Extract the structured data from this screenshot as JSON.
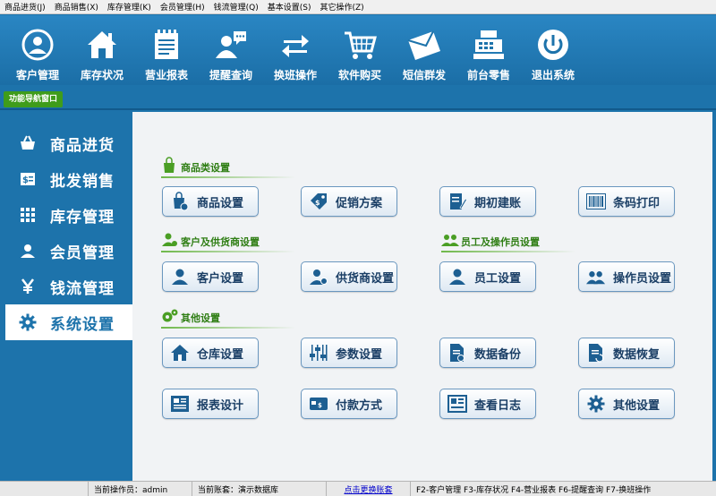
{
  "menu": [
    "商品进货(J)",
    "商品销售(X)",
    "库存管理(K)",
    "会员管理(H)",
    "钱流管理(Q)",
    "基本设置(S)",
    "其它操作(Z)"
  ],
  "toolbar": [
    {
      "label": "客户管理",
      "icon": "user-circle-icon"
    },
    {
      "label": "库存状况",
      "icon": "house-icon"
    },
    {
      "label": "营业报表",
      "icon": "notepad-icon"
    },
    {
      "label": "提醒查询",
      "icon": "chat-person-icon"
    },
    {
      "label": "换班操作",
      "icon": "swap-arrows-icon"
    },
    {
      "label": "软件购买",
      "icon": "cart-icon"
    },
    {
      "label": "短信群发",
      "icon": "envelope-icon"
    },
    {
      "label": "前台零售",
      "icon": "cash-register-icon"
    },
    {
      "label": "退出系统",
      "icon": "power-icon"
    }
  ],
  "nav_label": "功能导航窗口",
  "sidebar": [
    {
      "label": "商品进货",
      "icon": "basket-icon",
      "active": false
    },
    {
      "label": "批发销售",
      "icon": "price-tag-icon",
      "active": false
    },
    {
      "label": "库存管理",
      "icon": "grid-icon",
      "active": false
    },
    {
      "label": "会员管理",
      "icon": "person-icon",
      "active": false
    },
    {
      "label": "钱流管理",
      "icon": "yen-icon",
      "active": false
    },
    {
      "label": "系统设置",
      "icon": "gear-icon",
      "active": true
    }
  ],
  "sections": {
    "goods": "商品类设置",
    "customer": "客户及供货商设置",
    "staff": "员工及操作员设置",
    "other": "其他设置"
  },
  "buttons": {
    "goods_setting": "商品设置",
    "promotion": "促销方案",
    "opening": "期初建账",
    "barcode": "条码打印",
    "customer_setting": "客户设置",
    "supplier_setting": "供货商设置",
    "staff_setting": "员工设置",
    "operator_setting": "操作员设置",
    "warehouse": "仓库设置",
    "params": "参数设置",
    "backup": "数据备份",
    "restore": "数据恢复",
    "report_design": "报表设计",
    "payment": "付款方式",
    "log": "查看日志",
    "other": "其他设置"
  },
  "status": {
    "operator": "当前操作员：admin",
    "account": "当前账套：演示数据库",
    "switch_link": "点击更换账套",
    "hotkeys": "F2-客户管理  F3-库存状况  F4-营业报表  F6-提醒查询  F7-换班操作"
  },
  "colors": {
    "accent": "#1d73ab",
    "green": "#3f9c1b",
    "panel": "#f1f3f5"
  }
}
